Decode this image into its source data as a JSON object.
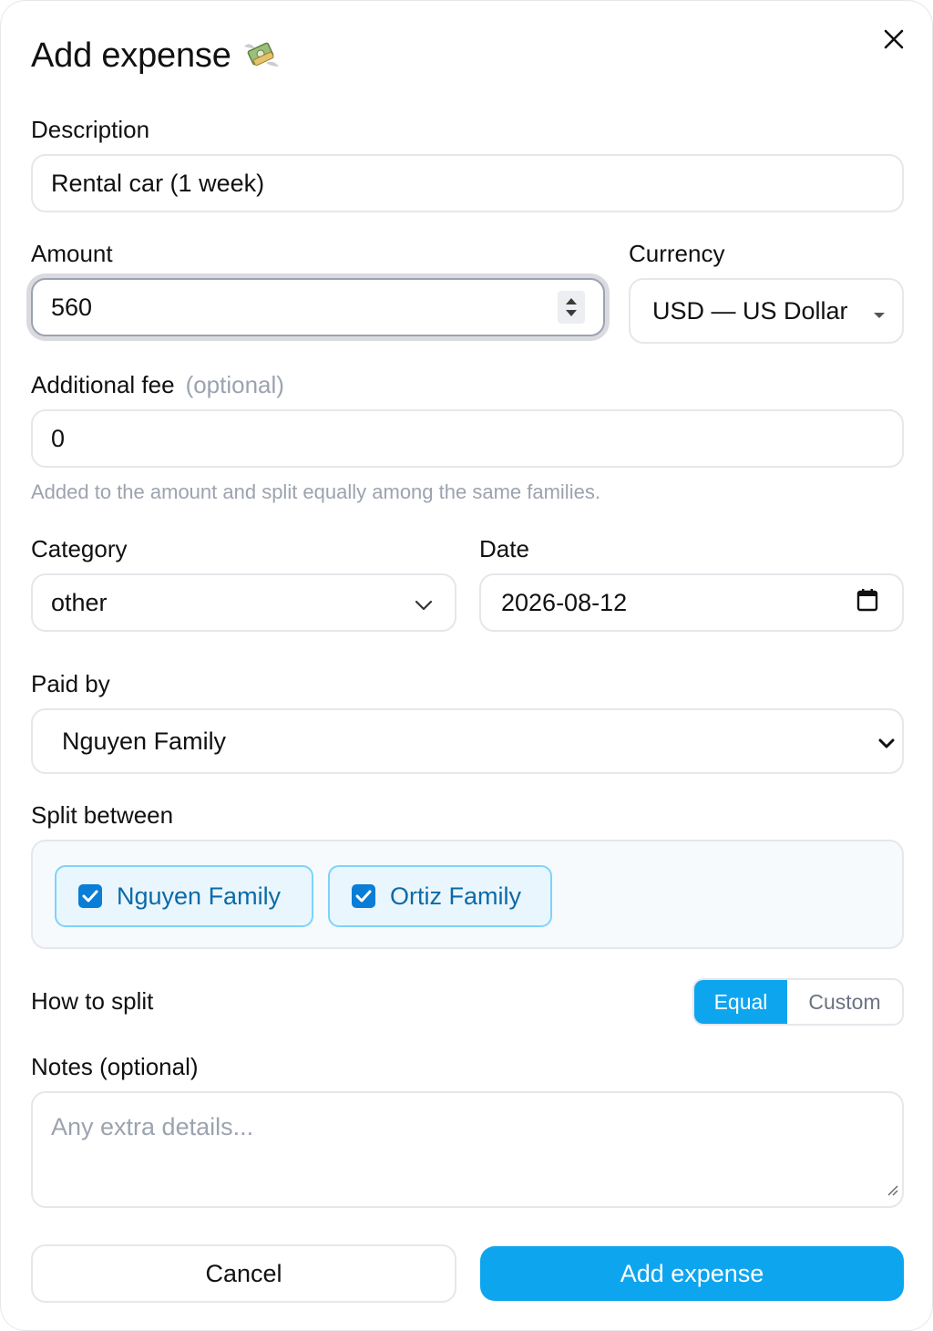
{
  "dialog": {
    "title": "Add expense",
    "title_icon": "money-with-wings-icon",
    "close_icon": "close-icon"
  },
  "description": {
    "label": "Description",
    "value": "Rental car (1 week)"
  },
  "amount": {
    "label": "Amount",
    "value": "560"
  },
  "currency": {
    "label": "Currency",
    "value": "USD — US Dollar"
  },
  "fee": {
    "label": "Additional fee",
    "optional": "(optional)",
    "value": "0",
    "helper": "Added to the amount and split equally among the same families."
  },
  "category": {
    "label": "Category",
    "value": "other"
  },
  "date": {
    "label": "Date",
    "value": "2026-08-12"
  },
  "paid_by": {
    "label": "Paid by",
    "value": "Nguyen Family"
  },
  "split_between": {
    "label": "Split between",
    "families": [
      {
        "name": "Nguyen Family",
        "checked": true
      },
      {
        "name": "Ortiz Family",
        "checked": true
      }
    ]
  },
  "how_to_split": {
    "label": "How to split",
    "options": [
      "Equal",
      "Custom"
    ],
    "selected": "Equal"
  },
  "notes": {
    "label": "Notes (optional)",
    "placeholder": "Any extra details..."
  },
  "actions": {
    "cancel": "Cancel",
    "submit": "Add expense"
  },
  "colors": {
    "accent": "#0ea5ef",
    "chip_border": "#7dd3fc",
    "chip_text": "#0b6aa8",
    "checkbox": "#0a7dd6"
  }
}
